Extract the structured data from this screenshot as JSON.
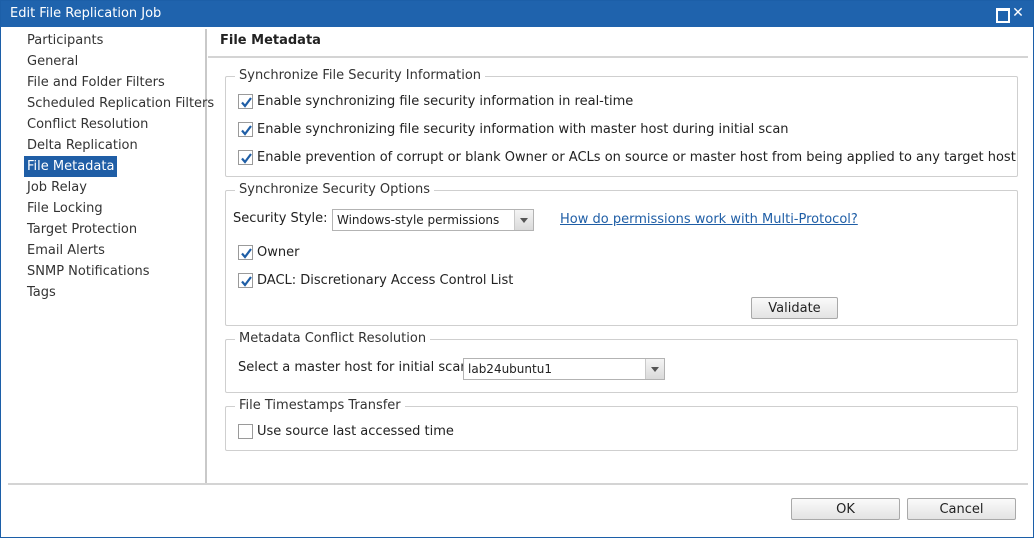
{
  "window": {
    "title": "Edit File Replication Job"
  },
  "sidebar": {
    "items": [
      {
        "label": "Participants"
      },
      {
        "label": "General"
      },
      {
        "label": "File and Folder Filters"
      },
      {
        "label": "Scheduled Replication Filters"
      },
      {
        "label": "Conflict Resolution"
      },
      {
        "label": "Delta Replication"
      },
      {
        "label": "File Metadata",
        "active": true
      },
      {
        "label": "Job Relay"
      },
      {
        "label": "File Locking"
      },
      {
        "label": "Target Protection"
      },
      {
        "label": "Email Alerts"
      },
      {
        "label": "SNMP Notifications"
      },
      {
        "label": "Tags"
      }
    ]
  },
  "content": {
    "title": "File Metadata",
    "sync_security_info": {
      "legend": "Synchronize File Security Information",
      "options": [
        {
          "label": "Enable synchronizing file security information in real-time",
          "checked": true
        },
        {
          "label": "Enable synchronizing file security information with master host during initial scan",
          "checked": true
        },
        {
          "label": "Enable prevention of corrupt or blank Owner or ACLs on source or master host from being applied to any target host",
          "checked": true
        }
      ]
    },
    "sync_security_options": {
      "legend": "Synchronize Security Options",
      "style_label": "Security Style:",
      "style_value": "Windows-style permissions",
      "help_link": "How do permissions work with Multi-Protocol?",
      "owner_label": "Owner",
      "owner_checked": true,
      "dacl_label": "DACL: Discretionary Access Control List",
      "dacl_checked": true,
      "validate_label": "Validate"
    },
    "metadata_conflict": {
      "legend": "Metadata Conflict Resolution",
      "master_label": "Select a master host for initial scan:",
      "master_value": "lab24ubuntu1"
    },
    "timestamps": {
      "legend": "File Timestamps Transfer",
      "last_accessed_label": "Use source last accessed time",
      "last_accessed_checked": false
    }
  },
  "footer": {
    "ok_label": "OK",
    "cancel_label": "Cancel"
  },
  "colors": {
    "accent": "#1f63ad",
    "link": "#1f5ea6",
    "check": "#1f5ea6"
  }
}
